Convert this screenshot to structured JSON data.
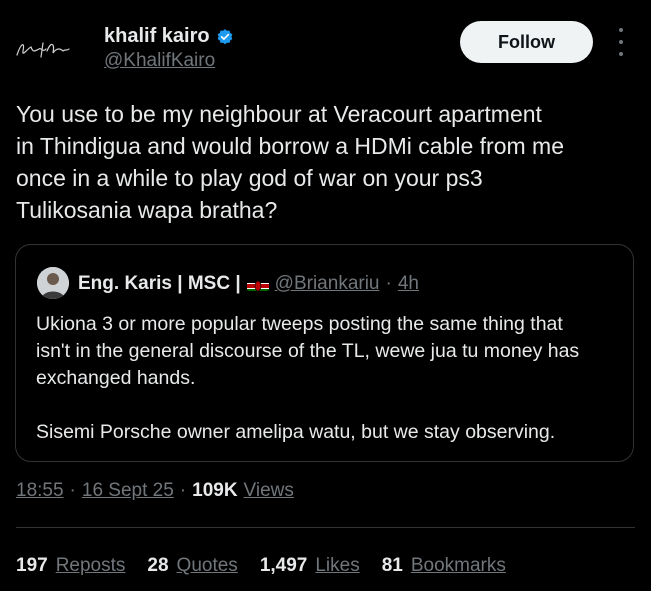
{
  "author": {
    "avatar_signature": "Khalif Kairo",
    "display_name": "khalif kairo",
    "handle": "@KhalifKairo",
    "verified_icon": "verified-badge-icon",
    "verified_color": "#1d9bf0"
  },
  "actions": {
    "follow_label": "Follow",
    "more_icon": "more-vertical-icon"
  },
  "tweet": {
    "text": "You use to be my neighbour at Veracourt apartment\nin Thindigua and would borrow a HDMi cable from me\nonce in a while to play god of war on your ps3\nTulikosania wapa bratha?"
  },
  "quote": {
    "name": "Eng. Karis | MSC |",
    "flag_icon": "kenya-flag-icon",
    "handle": "@Briankariu",
    "separator": "·",
    "time": "4h",
    "body": "Ukiona 3 or more popular tweeps posting the same thing that\nisn't in the general discourse of the TL, wewe jua tu money has\nexchanged hands.\n\nSisemi Porsche owner amelipa watu, but we stay observing."
  },
  "meta": {
    "time": "18:55",
    "sep1": "·",
    "date": "16 Sept 25",
    "sep2": "·",
    "views_count": "109K",
    "views_label": "Views"
  },
  "stats": [
    {
      "count": "197",
      "label": "Reposts"
    },
    {
      "count": "28",
      "label": "Quotes"
    },
    {
      "count": "1,497",
      "label": "Likes"
    },
    {
      "count": "81",
      "label": "Bookmarks"
    }
  ],
  "colors": {
    "background": "#000000",
    "text": "#e7e9ea",
    "muted": "#71767b",
    "border": "#2f3336",
    "button_bg": "#eff3f4"
  }
}
